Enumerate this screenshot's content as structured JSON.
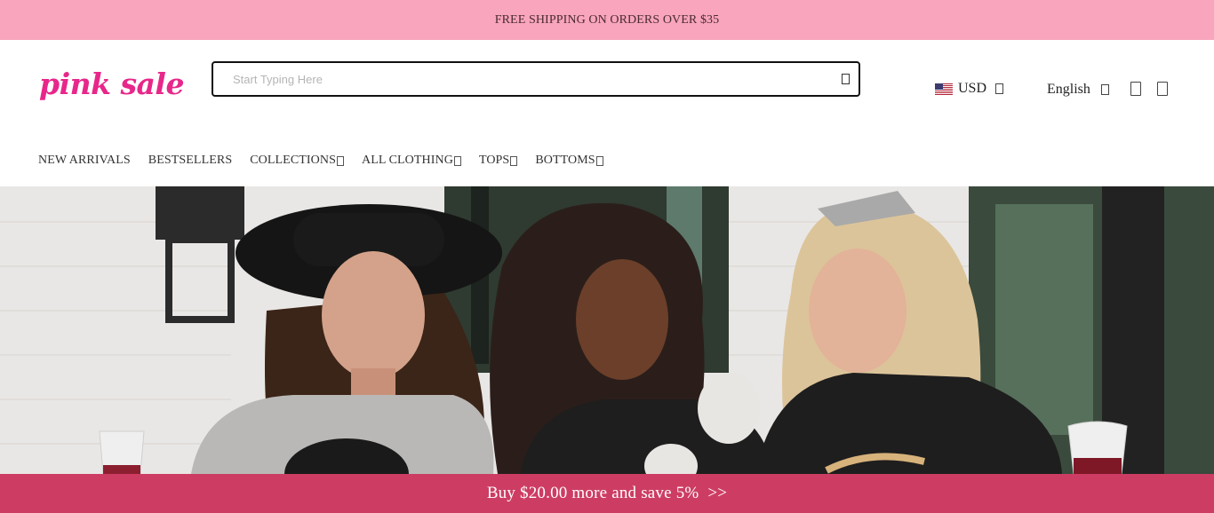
{
  "announcement": {
    "text": "FREE SHIPPING ON ORDERS OVER $35"
  },
  "brand": {
    "logo_text": "pink sale",
    "color": "#e8278a"
  },
  "search": {
    "placeholder": "Start Typing Here",
    "value": ""
  },
  "header": {
    "currency": {
      "label": "USD",
      "flag_icon": "us-flag-icon"
    },
    "language": {
      "label": "English"
    },
    "icons": [
      "account-icon",
      "cart-icon"
    ]
  },
  "nav": {
    "items": [
      {
        "label": "NEW ARRIVALS",
        "has_dropdown": false
      },
      {
        "label": "BESTSELLERS",
        "has_dropdown": false
      },
      {
        "label": "COLLECTIONS",
        "has_dropdown": true
      },
      {
        "label": "ALL CLOTHING",
        "has_dropdown": true
      },
      {
        "label": "TOPS",
        "has_dropdown": true
      },
      {
        "label": "BOTTOMS",
        "has_dropdown": true
      }
    ]
  },
  "promo_bar": {
    "text": "Buy $20.00 more and save 5%  >>"
  },
  "colors": {
    "announcement_bg": "#f8a5bd",
    "promo_bg": "#cd3d63",
    "accent": "#e8278a"
  }
}
